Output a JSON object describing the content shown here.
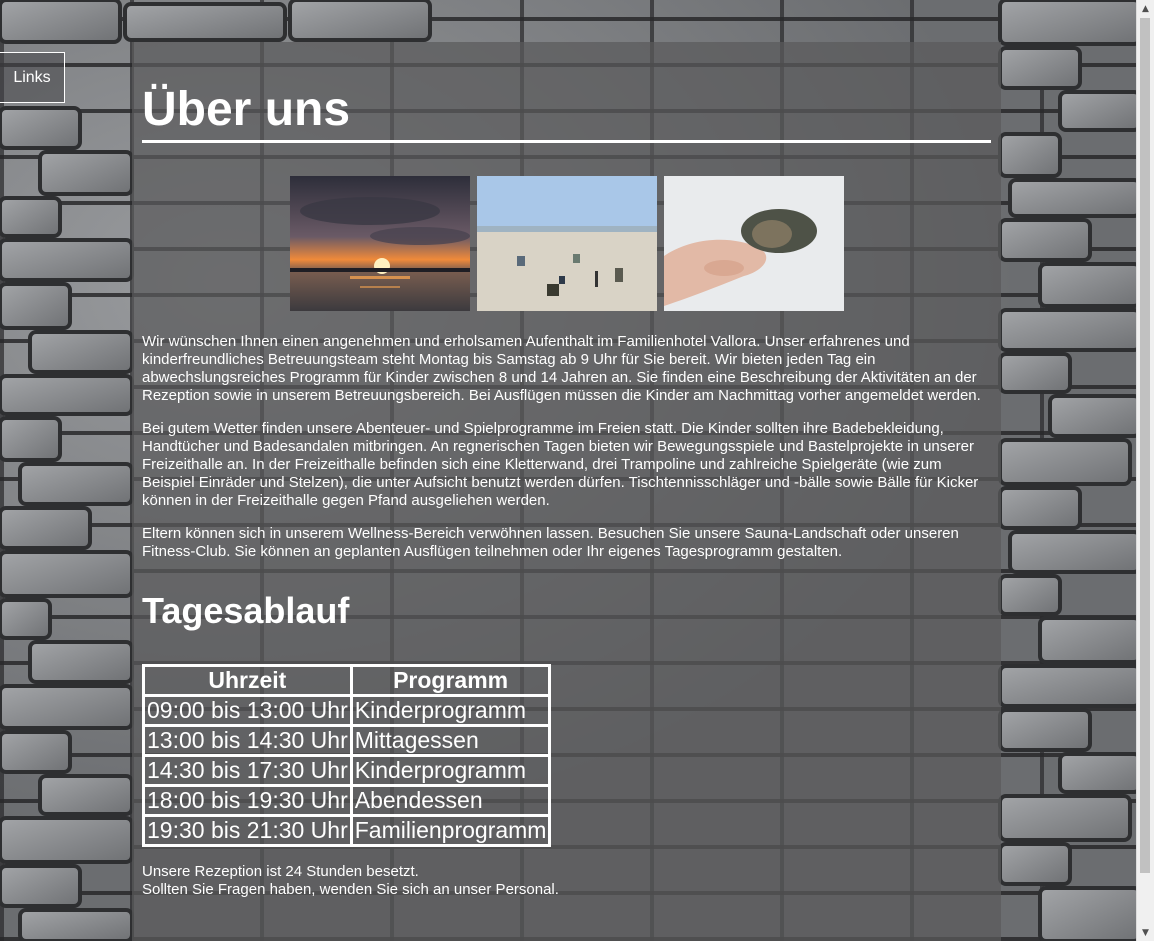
{
  "nav": {
    "links_label": "Links"
  },
  "page": {
    "title": "Über uns"
  },
  "intro": {
    "paragraphs": [
      "Wir wünschen Ihnen einen angenehmen und erholsamen Aufenthalt im Familienhotel Vallora. Unser erfahrenes und kinderfreundliches Betreuungsteam steht Montag bis Samstag ab 9 Uhr für Sie bereit. Wir bieten jeden Tag ein abwechslungsreiches Programm für Kinder zwischen 8 und 14 Jahren an. Sie finden eine Beschreibung der Aktivitäten an der Rezeption sowie in unserem Betreuungsbereich. Bei Ausflügen müssen die Kinder am Nachmittag vorher angemeldet werden.",
      "Bei gutem Wetter finden unsere Abenteuer- und Spielprogramme im Freien statt. Die Kinder sollten ihre Badebekleidung, Handtücher und Badesandalen mitbringen. An regnerischen Tagen bieten wir Bewegungsspiele und Bastelprojekte in unserer Freizeithalle an. In der Freizeithalle befinden sich eine Kletterwand, drei Trampoline und zahlreiche Spielgeräte (wie zum Beispiel Einräder und Stelzen), die unter Aufsicht benutzt werden dürfen. Tischtennisschläger und -bälle sowie Bälle für Kicker können in der Freizeithalle gegen Pfand ausgeliehen werden.",
      "Eltern können sich in unserem Wellness-Bereich verwöhnen lassen. Besuchen Sie unsere Sauna-Landschaft oder unseren Fitness-Club. Sie können an geplanten Ausflügen teilnehmen oder Ihr eigenes Tagesprogramm gestalten."
    ]
  },
  "schedule": {
    "title": "Tagesablauf",
    "headers": [
      "Uhrzeit",
      "Programm"
    ],
    "rows": [
      [
        "09:00 bis 13:00 Uhr",
        "Kinderprogramm"
      ],
      [
        "13:00 bis 14:30 Uhr",
        "Mittagessen"
      ],
      [
        "14:30 bis 17:30 Uhr",
        "Kinderprogramm"
      ],
      [
        "18:00 bis 19:30 Uhr",
        "Abendessen"
      ],
      [
        "19:30 bis 21:30 Uhr",
        "Familienprogramm"
      ]
    ]
  },
  "footer": {
    "line1": "Unsere Rezeption ist 24 Stunden besetzt.",
    "line2": "Sollten Sie Fragen haben, wenden Sie sich an unser Personal."
  },
  "scrollbar": {
    "up_icon": "triangle-up",
    "down_icon": "triangle-down"
  }
}
